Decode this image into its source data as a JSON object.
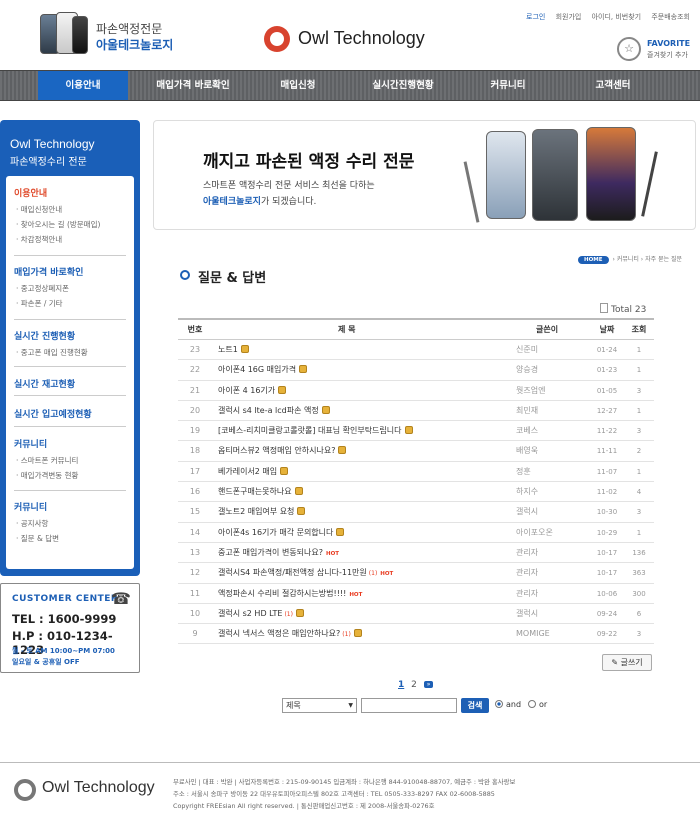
{
  "header": {
    "logo_sub": "파손액정전문",
    "logo_main": "아울테크놀로지",
    "brand": "Owl Technology",
    "util_links": [
      "로그인",
      "회원가입",
      "아이디, 비번찾기",
      "주문배송조회"
    ],
    "favorite_title": "FAVORITE",
    "favorite_sub": "즐겨찾기 추가"
  },
  "nav": [
    "이용안내",
    "매입가격 바로확인",
    "매입신청",
    "실시간진행현황",
    "커뮤니티",
    "고객센터"
  ],
  "sidebar": {
    "title1": "Owl Technology",
    "title2": "파손액정수리 전문",
    "sections": [
      {
        "title": "이용안내",
        "items": [
          "매입신청안내",
          "찾아오시는 길 (방문매입)",
          "차감정책안내"
        ]
      },
      {
        "title": "매입가격 바로확인",
        "items": [
          "중고정상폐지폰",
          "파손폰 / 기타"
        ]
      },
      {
        "title": "실시간 진행현황",
        "items": [
          "중고폰 매입 진행현황"
        ]
      },
      {
        "title": "실시간 재고현황",
        "items": []
      },
      {
        "title": "실시간 입고예정현황",
        "items": []
      },
      {
        "title": "커뮤니티",
        "items": [
          "스마트폰 커뮤니티",
          "매입가격변동 현황"
        ]
      },
      {
        "title": "커뮤니티",
        "items": [
          "공지사항",
          "질문 & 답변"
        ]
      }
    ]
  },
  "customer_center": {
    "title": "CUSTOMER CENTER",
    "tel": "TEL : 1600-9999",
    "hp": "H.P : 010-1234-1223",
    "hours1": "월 - 토  AM 10:00~PM 07:00",
    "hours2": "일요일 & 공휴일  OFF"
  },
  "banner": {
    "title": "깨지고 파손된 액정 수리 전문",
    "line1": "스마트폰 액정수리 전문 서비스 최선을 다하는",
    "line2_highlight": "아울테크놀로지",
    "line2_rest": "가 되겠습니다."
  },
  "breadcrumb": {
    "home": "HOME",
    "path": "›  커뮤니티  ›  자주 묻는 질문"
  },
  "page_title": "질문 & 답변",
  "total": "Total 23",
  "table": {
    "headers": {
      "no": "번호",
      "subject": "제    목",
      "writer": "글쓴이",
      "date": "날짜",
      "hits": "조회"
    },
    "rows": [
      {
        "no": "23",
        "subject": "노트1",
        "writer": "신준미",
        "date": "01-24",
        "hits": "1",
        "lock": true,
        "hot": false,
        "cmt": ""
      },
      {
        "no": "22",
        "subject": "아이폰4 16G 매입가격",
        "writer": "양승경",
        "date": "01-23",
        "hits": "1",
        "lock": true,
        "hot": false,
        "cmt": ""
      },
      {
        "no": "21",
        "subject": "아이폰 4 16기가",
        "writer": "뭣즈업엔",
        "date": "01-05",
        "hits": "3",
        "lock": true,
        "hot": false,
        "cmt": ""
      },
      {
        "no": "20",
        "subject": "갤럭시 s4 lte-a lcd파손 액정",
        "writer": "최민재",
        "date": "12-27",
        "hits": "1",
        "lock": true,
        "hot": false,
        "cmt": ""
      },
      {
        "no": "19",
        "subject": "[코베스-리치미클랑고롤랏롤] 대표님 확인부탁드립니다",
        "writer": "코베스",
        "date": "11-22",
        "hots": "",
        "hits": "3",
        "lock": true,
        "hot": false,
        "cmt": ""
      },
      {
        "no": "18",
        "subject": "옵티머스뷰2 액정매입 안하시나요?",
        "writer": "배영욱",
        "date": "11-11",
        "hits": "2",
        "lock": true,
        "hot": false,
        "cmt": ""
      },
      {
        "no": "17",
        "subject": "베가레이서2 매입",
        "writer": "정훈",
        "date": "11-07",
        "hits": "1",
        "lock": true,
        "hot": false,
        "cmt": ""
      },
      {
        "no": "16",
        "subject": "핸드폰구매는못하나요",
        "writer": "하지수",
        "date": "11-02",
        "hits": "4",
        "lock": true,
        "hot": false,
        "cmt": ""
      },
      {
        "no": "15",
        "subject": "갤노트2 매입여부 요청",
        "writer": "갤럭시",
        "date": "10-30",
        "hits": "3",
        "lock": true,
        "hot": false,
        "cmt": ""
      },
      {
        "no": "14",
        "subject": "아이폰4s 16기가 매각 문의합니다",
        "writer": "아이포오온",
        "date": "10-29",
        "hits": "1",
        "lock": true,
        "hot": false,
        "cmt": ""
      },
      {
        "no": "13",
        "subject": "중고폰 매입가격이 변동되나요?",
        "writer": "관리자",
        "date": "10-17",
        "hits": "136",
        "lock": false,
        "hot": true,
        "cmt": ""
      },
      {
        "no": "12",
        "subject": "갤럭시S4 파손액정/패전액정 삽니다-11만원",
        "writer": "관리자",
        "date": "10-17",
        "hits": "363",
        "lock": false,
        "hot": true,
        "cmt": "(1)"
      },
      {
        "no": "11",
        "subject": "액정파손시 수리비 절감하시는방법!!!!",
        "writer": "관리자",
        "date": "10-06",
        "hits": "300",
        "lock": false,
        "hot": true,
        "cmt": ""
      },
      {
        "no": "10",
        "subject": "갤럭시 s2 HD LTE",
        "writer": "갤럭시",
        "date": "09-24",
        "hits": "6",
        "lock": true,
        "hot": false,
        "cmt": "(1)"
      },
      {
        "no": "9",
        "subject": "갤럭시 넥서스 액정은 매입안하나요?",
        "writer": "MOMIGE",
        "date": "09-22",
        "hits": "3",
        "lock": true,
        "hot": false,
        "cmt": "(1)"
      }
    ]
  },
  "write_button": "글쓰기",
  "pager": {
    "current": "1",
    "next_page": "2",
    "next_icon": "»"
  },
  "search": {
    "select_value": "제목",
    "input_value": "",
    "button": "검색",
    "radio_and": "and",
    "radio_or": "or"
  },
  "footer": {
    "brand": "Owl Technology",
    "line1": "무료사인  |  대표 : 박완  |  사업자등록번호 : 215-09-90145  입금계좌 : 하나은행 844-910048-88707, 예금주 : 박완 홍사랑보",
    "line2": "주소 : 서울시 송파구 방이동 22 대우유토피아오피스텔 802호  고객센터 : TEL 0505-333-8297    FAX 02-6008-5885",
    "line3": "Copyright FREEsian All right reserved.  |  통신판매업신고번호 : 제 2008-서울송파-0276호"
  },
  "colors": {
    "accent": "#1d5fb5",
    "nav_bg": "#646669",
    "hot": "#e8391e",
    "brand_icon": "#d8432e"
  }
}
